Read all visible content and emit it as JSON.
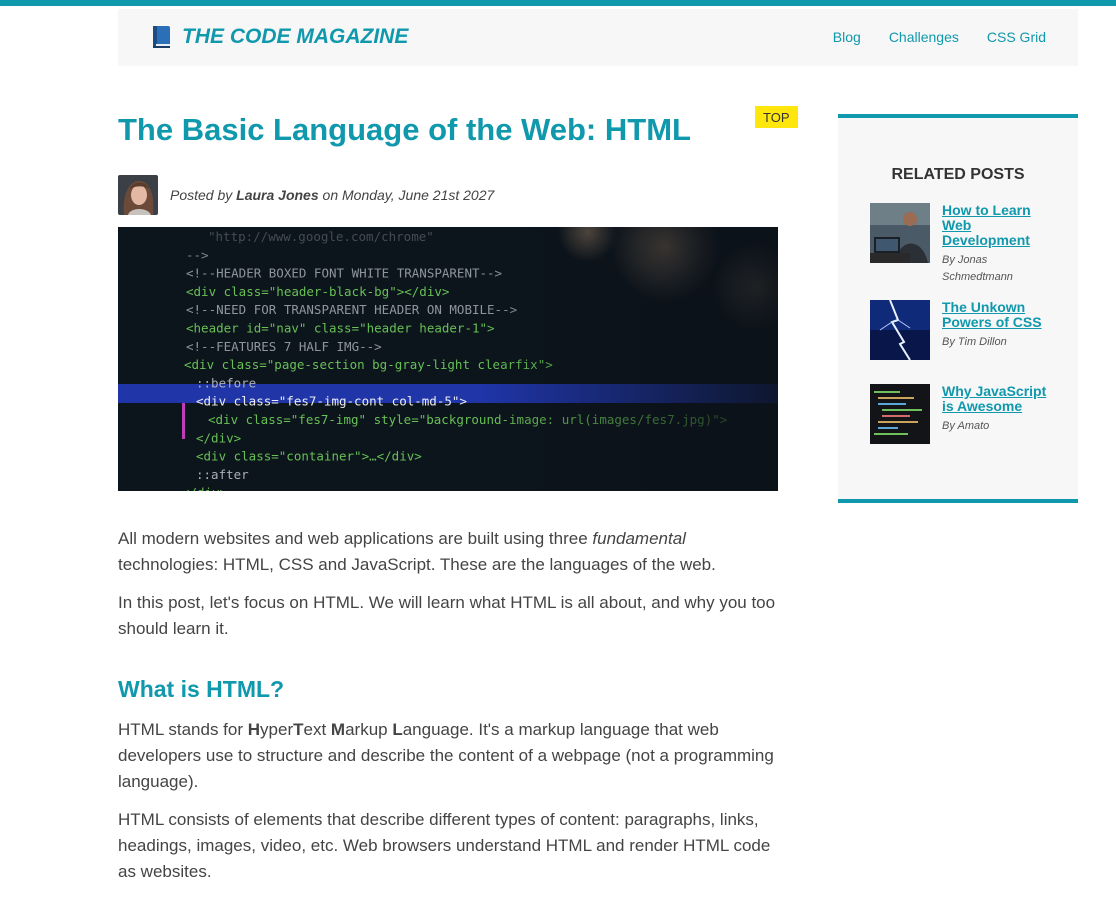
{
  "header": {
    "logo_icon": "book-icon",
    "logo_text": "THE CODE MAGAZINE",
    "nav": [
      {
        "label": "Blog"
      },
      {
        "label": "Challenges"
      },
      {
        "label": "CSS Grid"
      }
    ]
  },
  "article": {
    "badge": "TOP",
    "title": "The Basic Language of the Web: HTML",
    "byline": {
      "prefix": "Posted by",
      "author": "Laura Jones",
      "middle": "on",
      "date": "Monday, June 21st 2027"
    },
    "intro_p1": {
      "before": "All modern websites and web applications are built using three ",
      "em": "fundamental",
      "after": " technologies: HTML, CSS and JavaScript. These are the languages of the web."
    },
    "intro_p2": "In this post, let's focus on HTML. We will learn what HTML is all about, and why you too should learn it.",
    "section_heading": "What is HTML?",
    "def_p": {
      "pre": "HTML stands for ",
      "h": "H",
      "yper": "yper",
      "t": "T",
      "ext": "ext ",
      "m": "M",
      "arkup": "arkup ",
      "l": "L",
      "anguage": "anguage",
      "rest": ". It's a markup language that web developers use to structure and describe the content of a webpage (not a programming language)."
    },
    "elements_p": "HTML consists of elements that describe different types of content: paragraphs, links, headings, images, video, etc. Web browsers understand HTML and render HTML code as websites."
  },
  "sidebar": {
    "title": "RELATED POSTS",
    "posts": [
      {
        "title": "How to Learn Web Development",
        "author": "By Jonas Schmedtmann"
      },
      {
        "title": "The Unkown Powers of CSS",
        "author": "By Tim Dillon"
      },
      {
        "title": "Why JavaScript is Awesome",
        "author": "By Amato"
      }
    ]
  },
  "code_image": {
    "lines": [
      "\"http://www.google.com/chrome\"",
      "-->",
      "<!--HEADER BOXED FONT WHITE TRANSPARENT-->",
      "<div class=\"header-black-bg\"></div>",
      "<!--NEED FOR TRANSPARENT HEADER ON MOBILE-->",
      "<header id=\"nav\" class=\"header header-1\">",
      "<!--FEATURES 7 HALF IMG-->",
      "<div class=\"page-section bg-gray-light clearfix\">",
      "::before",
      "<div class=\"fes7-img-cont col-md-5\">",
      "<div class=\"fes7-img\" style=\"background-image: url(images/fes7.jpg)\">",
      "</div>",
      "<div class=\"container\">…</div>",
      "::after",
      "</div>"
    ]
  },
  "colors": {
    "accent": "#1098ad",
    "badge": "#ffe70e",
    "panel": "#f7f7f7"
  }
}
